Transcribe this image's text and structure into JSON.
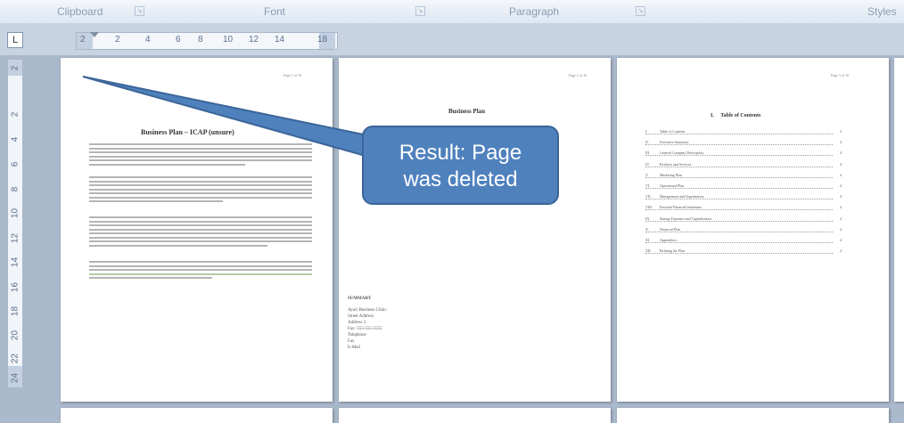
{
  "ribbon": {
    "groups": [
      "Clipboard",
      "Font",
      "Paragraph",
      "Styles"
    ],
    "launcher_glyph": "↘"
  },
  "ruler": {
    "tab_selector": "L",
    "horizontal_numbers": [
      "2",
      "2",
      "4",
      "6",
      "8",
      "10",
      "12",
      "14",
      "18"
    ],
    "vertical_numbers": [
      "2",
      "2",
      "4",
      "6",
      "8",
      "10",
      "12",
      "14",
      "16",
      "18",
      "20",
      "22",
      "24"
    ]
  },
  "pages": [
    {
      "page_number": "Page 1 of 10",
      "title": "Business Plan – ICAP (unsure)"
    },
    {
      "page_number": "Page 2 of 10",
      "title": "Business Plan",
      "contact_heading": "SUMMARY",
      "contact_lines": [
        "Ayuri Business Clinic",
        "Street Address",
        "Address 2",
        "Fax: 555-555-5555",
        "Telephone",
        "Fax",
        "E-Mail"
      ]
    },
    {
      "page_number": "Page 3 of 10",
      "title": "I.     Table of Contents",
      "toc": [
        {
          "num": "I.",
          "label": "Table of Contents",
          "page": "3"
        },
        {
          "num": "II.",
          "label": "Executive Summary",
          "page": "4"
        },
        {
          "num": "III.",
          "label": "General Company Description",
          "page": "4"
        },
        {
          "num": "IV.",
          "label": "Products and Services",
          "page": "4"
        },
        {
          "num": "V.",
          "label": "Marketing Plan",
          "page": "4"
        },
        {
          "num": "VI.",
          "label": "Operational Plan",
          "page": "4"
        },
        {
          "num": "VII.",
          "label": "Management and Organization",
          "page": "4"
        },
        {
          "num": "VIII.",
          "label": "Personal Financial Statement",
          "page": "4"
        },
        {
          "num": "IX.",
          "label": "Startup Expenses and Capitalization",
          "page": "4"
        },
        {
          "num": "X.",
          "label": "Financial Plan",
          "page": "4"
        },
        {
          "num": "XI.",
          "label": "Appendices",
          "page": "4"
        },
        {
          "num": "XII.",
          "label": "Refining the Plan",
          "page": "4"
        }
      ]
    }
  ],
  "callout": {
    "line1": "Result: Page",
    "line2": "was deleted",
    "fill_color": "#4f81bd",
    "arrow_color": "#3b6598"
  }
}
